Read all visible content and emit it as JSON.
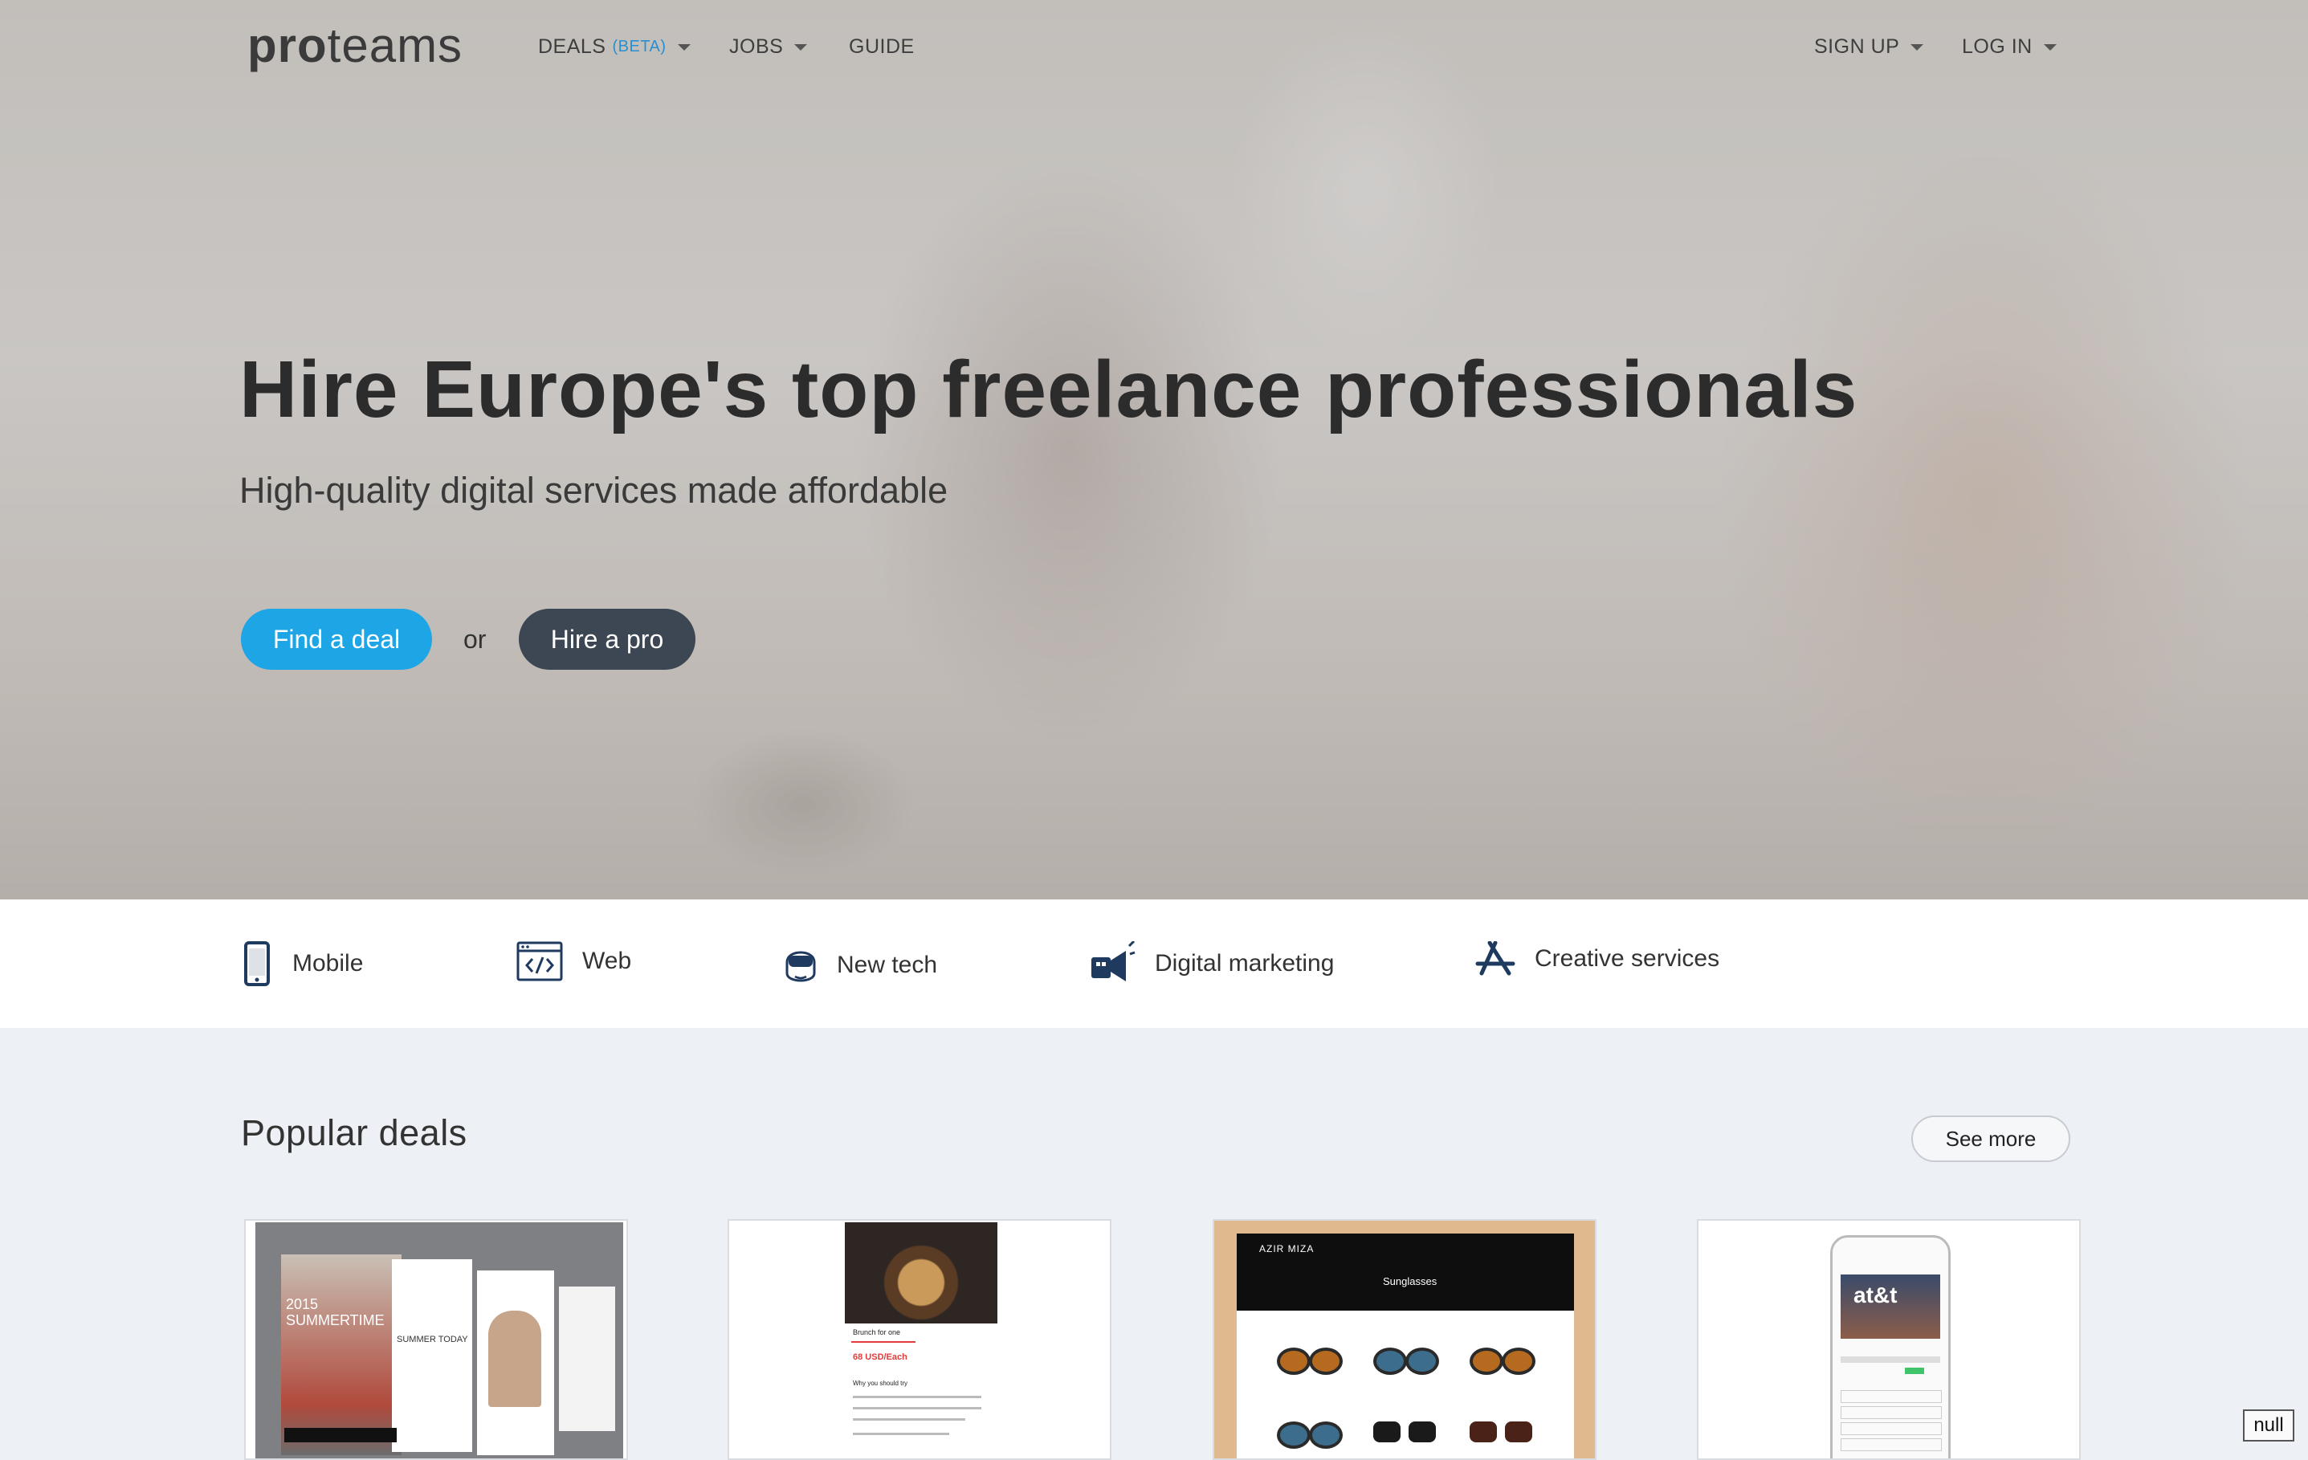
{
  "nav": {
    "logo_bold": "pro",
    "logo_light": "teams",
    "deals_label": "DEALS",
    "deals_badge": "(BETA)",
    "jobs_label": "JOBS",
    "guide_label": "GUIDE",
    "signup_label": "SIGN UP",
    "login_label": "LOG IN"
  },
  "hero": {
    "headline": "Hire Europe's top freelance professionals",
    "subline": "High-quality digital services made affordable",
    "find_deal_label": "Find a deal",
    "or_label": "or",
    "hire_pro_label": "Hire a pro"
  },
  "categories": [
    {
      "label": "Mobile",
      "icon": "mobile-phone-icon"
    },
    {
      "label": "Web",
      "icon": "web-code-icon"
    },
    {
      "label": "New tech",
      "icon": "vr-headset-icon"
    },
    {
      "label": "Digital marketing",
      "icon": "megaphone-icon"
    },
    {
      "label": "Creative services",
      "icon": "app-store-icon"
    }
  ],
  "popular": {
    "title": "Popular deals",
    "see_more_label": "See more"
  },
  "cards": [
    {
      "preview_text": "2015 SUMMERTIME",
      "preview_subtext": "SUMMER TODAY"
    },
    {
      "preview_text": "Brunch for one",
      "preview_price": "68 USD/Each",
      "preview_section": "Why you should try"
    },
    {
      "preview_text": "Sunglasses",
      "preview_brand": "AZIR MIZA"
    },
    {
      "preview_text": "at&t"
    }
  ],
  "badge": {
    "label": "null"
  },
  "colors": {
    "primary": "#1ea5e6",
    "dark_button": "#3c4753",
    "accent_beta": "#2a8fd0",
    "icon_navy": "#1f3a5f"
  }
}
